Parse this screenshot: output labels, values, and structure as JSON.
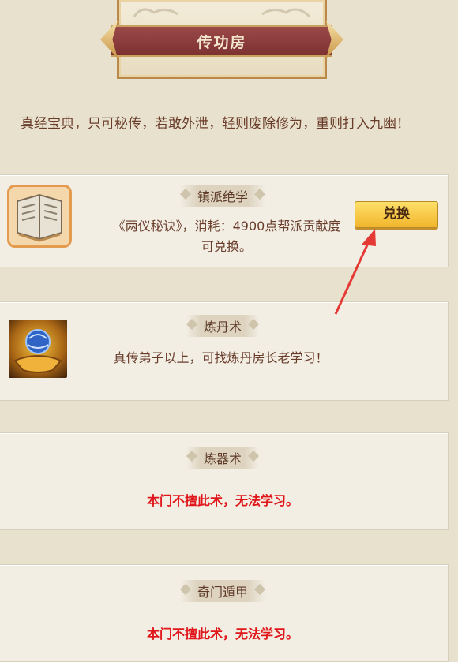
{
  "header": {
    "title": "传功房"
  },
  "intro": {
    "text": "真经宝典，只可秘传，若敢外泄，轻则废除修为，重则打入九幽！"
  },
  "cards": [
    {
      "tag": "镇派绝学",
      "desc": "《两仪秘诀》，消耗：4900点帮派贡献度可兑换。",
      "button": "兑换",
      "icon": "book-icon"
    },
    {
      "tag": "炼丹术",
      "desc": "真传弟子以上，可找炼丹房长老学习！",
      "icon": "orb-icon"
    },
    {
      "tag": "炼器术",
      "desc": "本门不擅此术，无法学习。"
    },
    {
      "tag": "奇门遁甲",
      "desc": "本门不擅此术，无法学习。"
    }
  ],
  "colors": {
    "background": "#e8e1cd",
    "accent_red": "#e0161a",
    "button_gold": "#f1b52c",
    "annotation_arrow": "#e53935"
  }
}
